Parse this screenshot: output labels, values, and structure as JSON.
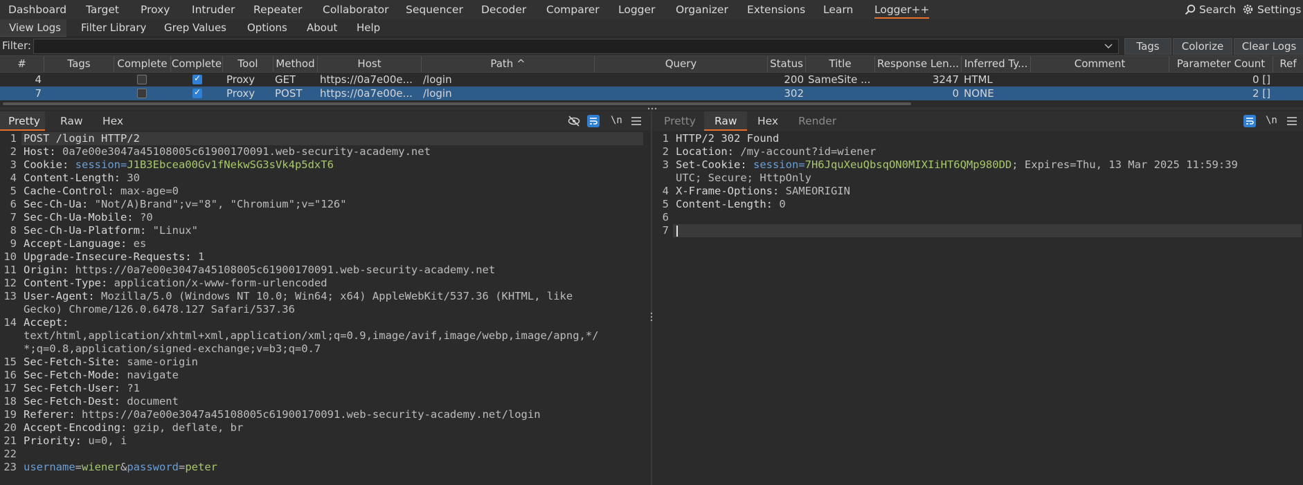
{
  "nav": {
    "items": [
      "Dashboard",
      "Target",
      "Proxy",
      "Intruder",
      "Repeater",
      "Collaborator",
      "Sequencer",
      "Decoder",
      "Comparer",
      "Logger",
      "Organizer",
      "Extensions",
      "Learn",
      "Logger++"
    ],
    "search": "Search",
    "settings": "Settings",
    "accent": "#e8702a"
  },
  "subnav": {
    "items": [
      "View Logs",
      "Filter Library",
      "Grep Values",
      "Options",
      "About",
      "Help"
    ]
  },
  "filter": {
    "label": "Filter:",
    "value": "",
    "buttons": [
      "Tags",
      "Colorize",
      "Clear Logs"
    ]
  },
  "table": {
    "columns": [
      "#",
      "Tags",
      "Complete",
      "Complete",
      "Tool",
      "Method",
      "Host",
      "Path ^",
      "Query",
      "Status",
      "Title",
      "Response Len...",
      "Inferred Ty...",
      "Comment",
      "Parameter Count",
      "Ref"
    ],
    "rows": [
      {
        "num": "4",
        "tags": "",
        "c1": false,
        "c2": true,
        "tool": "Proxy",
        "method": "GET",
        "host": "https://0a7e00e...",
        "path": "/login",
        "query": "",
        "status": "200",
        "title": "SameSite ...",
        "resplen": "3247",
        "type": "HTML",
        "comment": "",
        "params": "0 []",
        "selected": false
      },
      {
        "num": "7",
        "tags": "",
        "c1": false,
        "c2": true,
        "tool": "Proxy",
        "method": "POST",
        "host": "https://0a7e00e...",
        "path": "/login",
        "query": "",
        "status": "302",
        "title": "",
        "resplen": "0",
        "type": "NONE",
        "comment": "",
        "params": "2 []",
        "selected": true
      }
    ],
    "selected_color": "#2d5b8a"
  },
  "request": {
    "tabs": [
      "Pretty",
      "Raw",
      "Hex"
    ],
    "active_tab": "Pretty",
    "tool_icons": [
      "eye-off-icon",
      "wrap-icon",
      "newline-icon",
      "menu-icon"
    ],
    "newline_label": "\\n",
    "lines": [
      {
        "n": "1",
        "k": "POST /login HTTP/2",
        "v": ""
      },
      {
        "n": "2",
        "k": "Host: ",
        "v": "0a7e00e3047a45108005c61900170091.web-security-academy.net"
      },
      {
        "n": "3",
        "k": "Cookie: ",
        "v": "session=",
        "g": "J1B3Ebcea00Gv1fNekwSG3sVk4p5dxT6"
      },
      {
        "n": "4",
        "k": "Content-Length: ",
        "v": "30"
      },
      {
        "n": "5",
        "k": "Cache-Control: ",
        "v": "max-age=0"
      },
      {
        "n": "6",
        "k": "Sec-Ch-Ua: ",
        "v": "\"Not/A)Brand\";v=\"8\", \"Chromium\";v=\"126\""
      },
      {
        "n": "7",
        "k": "Sec-Ch-Ua-Mobile: ",
        "v": "?0"
      },
      {
        "n": "8",
        "k": "Sec-Ch-Ua-Platform: ",
        "v": "\"Linux\""
      },
      {
        "n": "9",
        "k": "Accept-Language: ",
        "v": "es"
      },
      {
        "n": "10",
        "k": "Upgrade-Insecure-Requests: ",
        "v": "1"
      },
      {
        "n": "11",
        "k": "Origin: ",
        "v": "https://0a7e00e3047a45108005c61900170091.web-security-academy.net"
      },
      {
        "n": "12",
        "k": "Content-Type: ",
        "v": "application/x-www-form-urlencoded"
      },
      {
        "n": "13",
        "k": "User-Agent: ",
        "v": "Mozilla/5.0 (Windows NT 10.0; Win64; x64) AppleWebKit/537.36 (KHTML, like"
      },
      {
        "n": "",
        "k": "",
        "v": "Gecko) Chrome/126.0.6478.127 Safari/537.36"
      },
      {
        "n": "14",
        "k": "Accept: ",
        "v": ""
      },
      {
        "n": "",
        "k": "",
        "v": "text/html,application/xhtml+xml,application/xml;q=0.9,image/avif,image/webp,image/apng,*/"
      },
      {
        "n": "",
        "k": "",
        "v": "*;q=0.8,application/signed-exchange;v=b3;q=0.7"
      },
      {
        "n": "15",
        "k": "Sec-Fetch-Site: ",
        "v": "same-origin"
      },
      {
        "n": "16",
        "k": "Sec-Fetch-Mode: ",
        "v": "navigate"
      },
      {
        "n": "17",
        "k": "Sec-Fetch-User: ",
        "v": "?1"
      },
      {
        "n": "18",
        "k": "Sec-Fetch-Dest: ",
        "v": "document"
      },
      {
        "n": "19",
        "k": "Referer: ",
        "v": "https://0a7e00e3047a45108005c61900170091.web-security-academy.net/login"
      },
      {
        "n": "20",
        "k": "Accept-Encoding: ",
        "v": "gzip, deflate, br"
      },
      {
        "n": "21",
        "k": "Priority: ",
        "v": "u=0, i"
      },
      {
        "n": "22",
        "k": "",
        "v": ""
      }
    ],
    "body_line": {
      "n": "23",
      "p1": "username",
      "p1v": "wiener",
      "amp": "&",
      "p2": "password",
      "p2v": "peter",
      "eq": "="
    }
  },
  "response": {
    "tabs": [
      "Pretty",
      "Raw",
      "Hex",
      "Render"
    ],
    "active_tab": "Raw",
    "newline_label": "\\n",
    "lines": [
      {
        "n": "1",
        "k": "HTTP/2 302 Found",
        "v": ""
      },
      {
        "n": "2",
        "k": "Location: ",
        "v": "/my-account?id=wiener"
      },
      {
        "n": "3",
        "k": "Set-Cookie: ",
        "v": "session=",
        "g": "7H6JquXeuQbsqON0MIXIiHT6QMp980DD",
        "t": "; Expires=Thu, 13 Mar 2025 11:59:39"
      },
      {
        "n": "",
        "k": "",
        "v": "UTC; Secure; HttpOnly"
      },
      {
        "n": "4",
        "k": "X-Frame-Options: ",
        "v": "SAMEORIGIN"
      },
      {
        "n": "5",
        "k": "Content-Length: ",
        "v": "0"
      },
      {
        "n": "6",
        "k": "",
        "v": ""
      },
      {
        "n": "7",
        "k": "",
        "v": ""
      }
    ]
  }
}
